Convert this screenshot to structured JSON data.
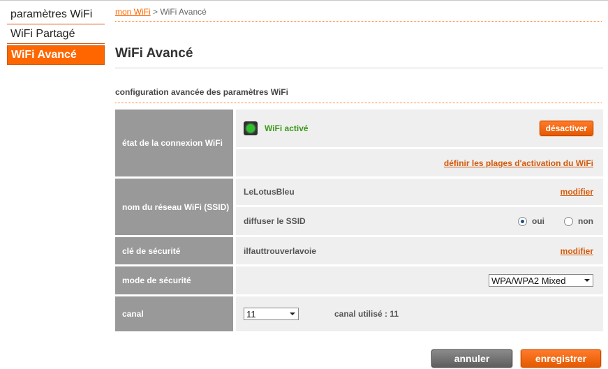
{
  "sidebar": {
    "items": [
      {
        "label": "paramètres WiFi"
      },
      {
        "label": "WiFi Partagé"
      },
      {
        "label": "WiFi Avancé"
      }
    ]
  },
  "breadcrumb": {
    "link": "mon WiFi",
    "separator": " > ",
    "current": "WiFi Avancé"
  },
  "page": {
    "title": "WiFi Avancé",
    "section": "configuration avancée des paramètres WiFi"
  },
  "rows": {
    "connection": {
      "label": "état de la connexion WiFi",
      "status": "WiFi activé",
      "button": "désactiver",
      "schedule_link": "définir les plages d'activation du WiFi"
    },
    "ssid": {
      "label": "nom du réseau WiFi (SSID)",
      "value": "LeLotusBleu",
      "modify": "modifier",
      "broadcast_label": "diffuser le SSID",
      "yes": "oui",
      "no": "non",
      "broadcast_selected": "oui"
    },
    "key": {
      "label": "clé de sécurité",
      "value": "ilfauttrouverlavoie",
      "modify": "modifier"
    },
    "mode": {
      "label": "mode de sécurité",
      "selected": "WPA/WPA2 Mixed"
    },
    "channel": {
      "label": "canal",
      "selected": "11",
      "used_text": "canal utilisé : 11"
    }
  },
  "actions": {
    "cancel": "annuler",
    "save": "enregistrer"
  },
  "colors": {
    "accent": "#ff6600",
    "label_bg": "#999999",
    "cell_bg": "#efefef",
    "status_green": "#3a9a1a"
  }
}
